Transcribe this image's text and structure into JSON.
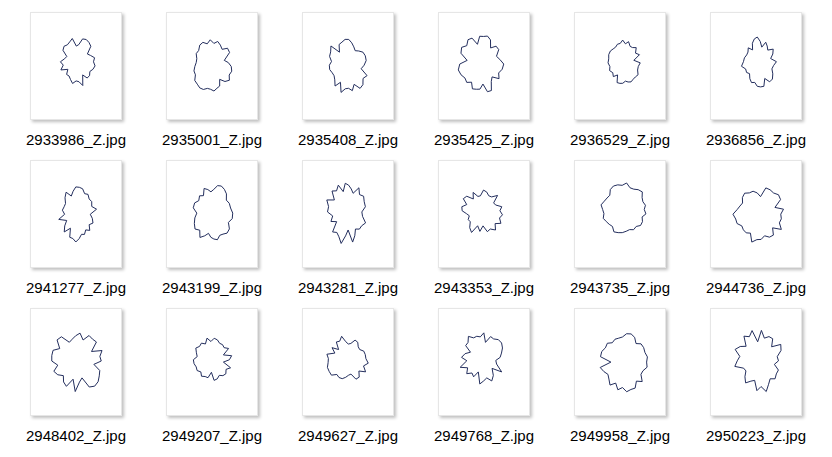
{
  "window": {
    "view": "Large icons"
  },
  "files": [
    {
      "name": "2933986_Z.jpg"
    },
    {
      "name": "2935001_Z.jpg"
    },
    {
      "name": "2935408_Z.jpg"
    },
    {
      "name": "2935425_Z.jpg"
    },
    {
      "name": "2936529_Z.jpg"
    },
    {
      "name": "2936856_Z.jpg"
    },
    {
      "name": "2941277_Z.jpg"
    },
    {
      "name": "2943199_Z.jpg"
    },
    {
      "name": "2943281_Z.jpg"
    },
    {
      "name": "2943353_Z.jpg"
    },
    {
      "name": "2943735_Z.jpg"
    },
    {
      "name": "2944736_Z.jpg"
    },
    {
      "name": "2948402_Z.jpg"
    },
    {
      "name": "2949207_Z.jpg"
    },
    {
      "name": "2949627_Z.jpg"
    },
    {
      "name": "2949768_Z.jpg"
    },
    {
      "name": "2949958_Z.jpg"
    },
    {
      "name": "2950223_Z.jpg"
    }
  ]
}
